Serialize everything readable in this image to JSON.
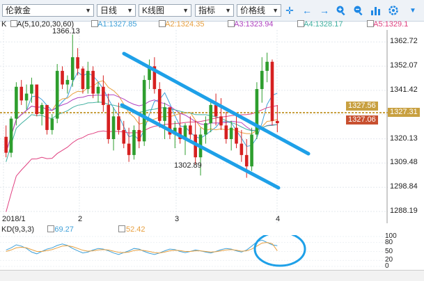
{
  "toolbar": {
    "symbol": "伦敦金",
    "period": "日线",
    "chart_type": "K线图",
    "indicator": "指标",
    "price_line": "价格线"
  },
  "legend": {
    "k_label": "K",
    "ma_main": "MA(5,10,20,30,60)",
    "ma1": "MA1:1327.85",
    "ma2": "MA2:1324.35",
    "ma3": "MA3:1323.94",
    "ma4": "MA4:1328.17",
    "ma5": "MA5:1329.1"
  },
  "annotations": {
    "high": "1366.13",
    "low": "1302.89"
  },
  "y_axis": [
    "1362.72",
    "1352.07",
    "1341.42",
    "1330.78",
    "1320.13",
    "1309.48",
    "1298.84",
    "1288.19"
  ],
  "x_axis": [
    "2018/1",
    "2",
    "3",
    "4"
  ],
  "price_boxes": {
    "upper": "1327.56",
    "current": "1327.31",
    "lower": "1327.06"
  },
  "kd": {
    "title": "KD(9,3,3)",
    "k": "K:69.27",
    "d": "D:52.42",
    "levels": [
      "100",
      "80",
      "50",
      "20",
      "0"
    ]
  },
  "colors": {
    "up": "#2e9e2e",
    "down": "#d62020",
    "trend": "#1ea0e8",
    "ma1": "#3fa0d8",
    "ma2": "#e8a040",
    "ma3": "#b040c0",
    "ma4": "#40b0a0",
    "ma5": "#e04080",
    "box_gold": "#c8a040",
    "box_red": "#c85030"
  },
  "chart_data": {
    "type": "candlestick",
    "ymin": 1283,
    "ymax": 1368,
    "candles": [
      [
        1321,
        1326,
        1312,
        1314
      ],
      [
        1314,
        1330,
        1312,
        1329
      ],
      [
        1329,
        1345,
        1326,
        1343
      ],
      [
        1343,
        1346,
        1335,
        1337
      ],
      [
        1337,
        1344,
        1333,
        1340
      ],
      [
        1340,
        1347,
        1336,
        1344
      ],
      [
        1344,
        1343,
        1330,
        1331
      ],
      [
        1331,
        1336,
        1326,
        1335
      ],
      [
        1335,
        1330,
        1322,
        1324
      ],
      [
        1324,
        1331,
        1322,
        1329
      ],
      [
        1329,
        1353,
        1327,
        1350
      ],
      [
        1350,
        1352,
        1342,
        1344
      ],
      [
        1344,
        1348,
        1340,
        1346
      ],
      [
        1346,
        1366,
        1343,
        1356
      ],
      [
        1356,
        1360,
        1348,
        1351
      ],
      [
        1351,
        1352,
        1340,
        1342
      ],
      [
        1342,
        1354,
        1340,
        1350
      ],
      [
        1350,
        1352,
        1338,
        1340
      ],
      [
        1340,
        1345,
        1336,
        1343
      ],
      [
        1343,
        1348,
        1332,
        1335
      ],
      [
        1335,
        1340,
        1318,
        1320
      ],
      [
        1320,
        1334,
        1315,
        1330
      ],
      [
        1330,
        1336,
        1322,
        1324
      ],
      [
        1324,
        1328,
        1316,
        1318
      ],
      [
        1318,
        1325,
        1310,
        1313
      ],
      [
        1313,
        1326,
        1311,
        1324
      ],
      [
        1324,
        1330,
        1316,
        1319
      ],
      [
        1319,
        1348,
        1317,
        1346
      ],
      [
        1346,
        1355,
        1342,
        1352
      ],
      [
        1352,
        1356,
        1340,
        1342
      ],
      [
        1342,
        1345,
        1325,
        1328
      ],
      [
        1328,
        1336,
        1320,
        1334
      ],
      [
        1334,
        1330,
        1320,
        1322
      ],
      [
        1322,
        1328,
        1316,
        1325
      ],
      [
        1325,
        1331,
        1318,
        1320
      ],
      [
        1320,
        1327,
        1313,
        1326
      ],
      [
        1326,
        1330,
        1320,
        1322
      ],
      [
        1322,
        1328,
        1309,
        1312
      ],
      [
        1312,
        1325,
        1304,
        1322
      ],
      [
        1322,
        1330,
        1318,
        1327
      ],
      [
        1327,
        1337,
        1323,
        1335
      ],
      [
        1335,
        1340,
        1326,
        1330
      ],
      [
        1330,
        1338,
        1324,
        1326
      ],
      [
        1326,
        1332,
        1318,
        1320
      ],
      [
        1320,
        1328,
        1315,
        1325
      ],
      [
        1325,
        1330,
        1316,
        1318
      ],
      [
        1318,
        1324,
        1310,
        1313
      ],
      [
        1313,
        1320,
        1303,
        1308
      ],
      [
        1308,
        1325,
        1306,
        1322
      ],
      [
        1322,
        1345,
        1320,
        1342
      ],
      [
        1342,
        1356,
        1336,
        1350
      ],
      [
        1350,
        1358,
        1345,
        1354
      ],
      [
        1354,
        1355,
        1326,
        1328
      ],
      [
        1328,
        1335,
        1323,
        1327
      ]
    ],
    "kd_k": [
      55,
      62,
      72,
      68,
      60,
      48,
      42,
      50,
      58,
      62,
      70,
      75,
      70,
      60,
      52,
      45,
      48,
      55,
      60,
      58,
      52,
      45,
      40,
      46,
      52,
      60,
      58,
      50,
      44,
      40,
      45,
      52,
      58,
      56,
      50,
      46,
      50,
      55,
      52,
      48,
      45,
      50,
      56,
      60,
      58,
      52,
      48,
      55,
      68,
      82,
      88,
      80,
      72,
      69
    ],
    "kd_d": [
      50,
      55,
      62,
      64,
      62,
      56,
      50,
      50,
      53,
      56,
      62,
      68,
      69,
      66,
      60,
      54,
      51,
      52,
      55,
      56,
      55,
      51,
      47,
      46,
      48,
      53,
      55,
      53,
      50,
      46,
      45,
      48,
      52,
      54,
      53,
      50,
      50,
      52,
      52,
      50,
      48,
      49,
      52,
      55,
      56,
      54,
      51,
      52,
      58,
      68,
      78,
      80,
      76,
      52
    ]
  }
}
